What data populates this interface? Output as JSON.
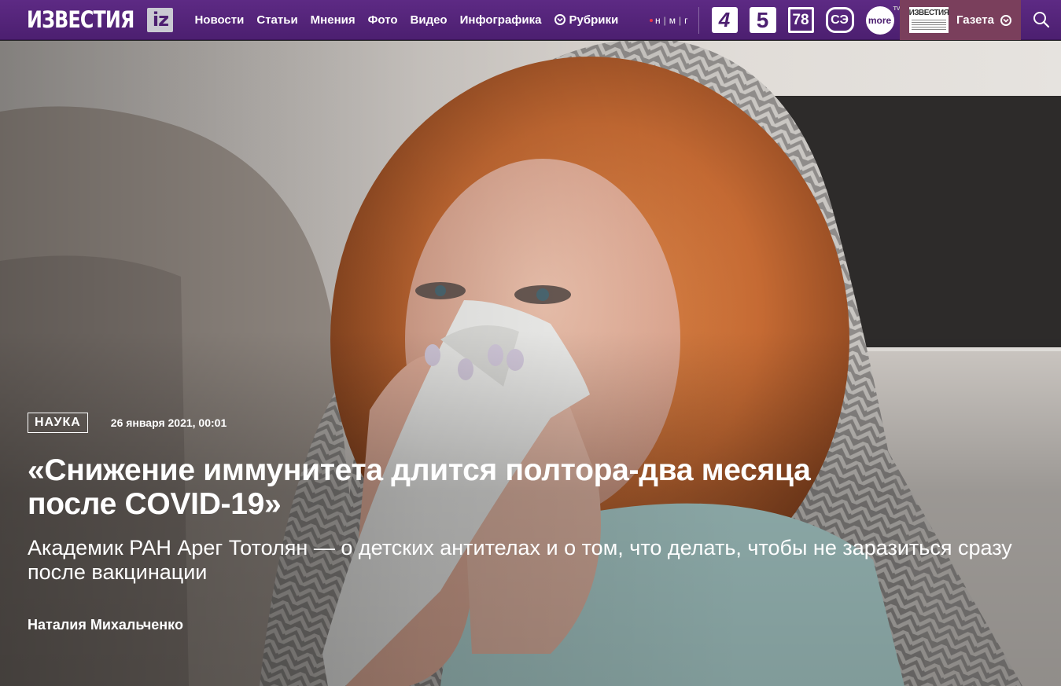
{
  "header": {
    "logo_text": "ИЗВЕСТИЯ",
    "logo_badge": "iz",
    "nav": [
      "Новости",
      "Статьи",
      "Мнения",
      "Фото",
      "Видео",
      "Инфографика"
    ],
    "rubrics_label": "Рубрики",
    "partners": {
      "nmg": [
        "н",
        "м",
        "г"
      ],
      "ch4": "4",
      "ch5": "5",
      "ch78": "78",
      "ctc": "СЭ",
      "more": "more",
      "more_tv": "TV"
    },
    "gazeta": {
      "logo_text": "ИЗВЕСТИЯ",
      "label": "Газета"
    }
  },
  "article": {
    "rubric": "НАУКА",
    "date": "26 января 2021, 00:01",
    "headline_line1": "«Снижение иммунитета длится полтора-два месяца",
    "headline_line2": "после COVID-19»",
    "subtitle": "Академик РАН Арег Тотолян — о детских антителах и о том, что делать, чтобы не заразиться сразу после вакцинации",
    "author": "Наталия Михальченко"
  },
  "colors": {
    "brand_purple": "#4c1f70",
    "gazeta_bg": "#7a3f5c",
    "nmg_dot": "#e8334a"
  }
}
